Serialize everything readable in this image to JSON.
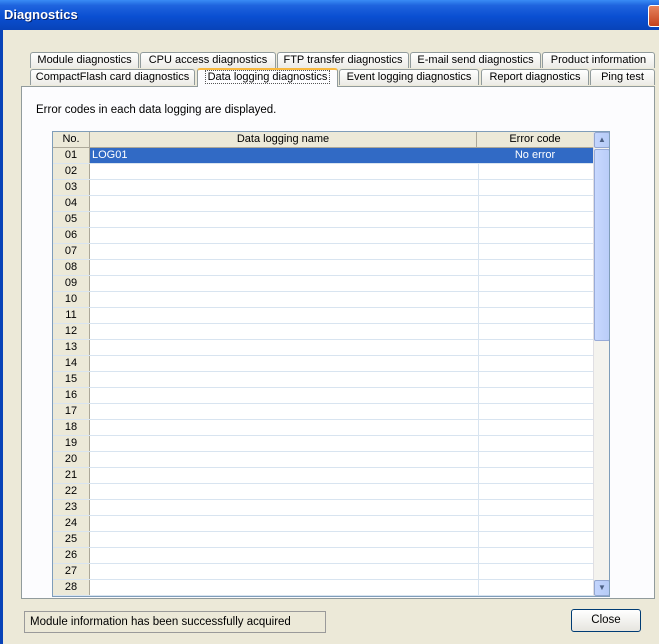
{
  "window": {
    "title": "Diagnostics"
  },
  "tabs_row1": [
    {
      "label": "Module diagnostics"
    },
    {
      "label": "CPU access diagnostics"
    },
    {
      "label": "FTP transfer diagnostics"
    },
    {
      "label": "E-mail send diagnostics"
    },
    {
      "label": "Product information"
    }
  ],
  "tabs_row2": [
    {
      "label": "CompactFlash card diagnostics"
    },
    {
      "label": "Data logging diagnostics",
      "active": true
    },
    {
      "label": "Event logging diagnostics"
    },
    {
      "label": "Report diagnostics"
    },
    {
      "label": "Ping test"
    }
  ],
  "panel": {
    "description": "Error codes in each data logging are displayed."
  },
  "table": {
    "headers": {
      "no": "No.",
      "name": "Data logging name",
      "error": "Error code"
    },
    "rows": [
      {
        "no": "01",
        "name": "LOG01",
        "error": "No error",
        "selected": true
      },
      {
        "no": "02",
        "name": "",
        "error": ""
      },
      {
        "no": "03",
        "name": "",
        "error": ""
      },
      {
        "no": "04",
        "name": "",
        "error": ""
      },
      {
        "no": "05",
        "name": "",
        "error": ""
      },
      {
        "no": "06",
        "name": "",
        "error": ""
      },
      {
        "no": "07",
        "name": "",
        "error": ""
      },
      {
        "no": "08",
        "name": "",
        "error": ""
      },
      {
        "no": "09",
        "name": "",
        "error": ""
      },
      {
        "no": "10",
        "name": "",
        "error": ""
      },
      {
        "no": "11",
        "name": "",
        "error": ""
      },
      {
        "no": "12",
        "name": "",
        "error": ""
      },
      {
        "no": "13",
        "name": "",
        "error": ""
      },
      {
        "no": "14",
        "name": "",
        "error": ""
      },
      {
        "no": "15",
        "name": "",
        "error": ""
      },
      {
        "no": "16",
        "name": "",
        "error": ""
      },
      {
        "no": "17",
        "name": "",
        "error": ""
      },
      {
        "no": "18",
        "name": "",
        "error": ""
      },
      {
        "no": "19",
        "name": "",
        "error": ""
      },
      {
        "no": "20",
        "name": "",
        "error": ""
      },
      {
        "no": "21",
        "name": "",
        "error": ""
      },
      {
        "no": "22",
        "name": "",
        "error": ""
      },
      {
        "no": "23",
        "name": "",
        "error": ""
      },
      {
        "no": "24",
        "name": "",
        "error": ""
      },
      {
        "no": "25",
        "name": "",
        "error": ""
      },
      {
        "no": "26",
        "name": "",
        "error": ""
      },
      {
        "no": "27",
        "name": "",
        "error": ""
      },
      {
        "no": "28",
        "name": "",
        "error": ""
      }
    ]
  },
  "status": {
    "message": "Module information has been successfully acquired"
  },
  "buttons": {
    "close": "Close"
  },
  "colors": {
    "selection": "#316ac5",
    "titlebar": "#0a4fd2",
    "active_tab_accent": "#f7b83e"
  },
  "icons": {
    "window_close": "close-icon",
    "scroll_up": "scroll-up-arrow-icon",
    "scroll_down": "scroll-down-arrow-icon"
  }
}
